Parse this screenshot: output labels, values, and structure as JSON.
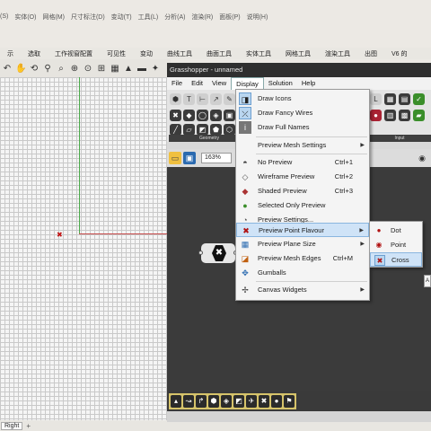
{
  "rhino": {
    "menu": [
      "(S)",
      "实体(O)",
      "网格(M)",
      "尺寸标注(D)",
      "变动(T)",
      "工具(L)",
      "分析(A)",
      "渲染(R)",
      "面板(P)",
      "说明(H)"
    ],
    "toolbar_tabs": [
      "示",
      "选取",
      "工作视窗配置",
      "可见性",
      "变动",
      "曲线工具",
      "曲面工具",
      "实体工具",
      "网格工具",
      "渲染工具",
      "出图",
      "V6 的"
    ],
    "viewport_tab": "Right",
    "add_viewport_glyph": "+"
  },
  "grasshopper": {
    "title": "Grasshopper - unnamed",
    "menu": [
      "File",
      "Edit",
      "View",
      "Display",
      "Solution",
      "Help"
    ],
    "open_menu": "Display",
    "zoom": "163%",
    "ribbon_labels": [
      "Geometry",
      "Input"
    ]
  },
  "display_menu": {
    "items": [
      {
        "label": "Draw Icons",
        "shortcut": "",
        "submenu": false,
        "icon": "icons-icon"
      },
      {
        "label": "Draw Fancy Wires",
        "shortcut": "",
        "submenu": false,
        "icon": "fancy-wires-icon"
      },
      {
        "label": "Draw Full Names",
        "shortcut": "",
        "submenu": false,
        "icon": "full-names-icon"
      },
      {
        "label": "Preview Mesh Settings",
        "shortcut": "",
        "submenu": true,
        "icon": ""
      },
      {
        "label": "No Preview",
        "shortcut": "Ctrl+1",
        "submenu": false,
        "icon": "no-preview-icon"
      },
      {
        "label": "Wireframe Preview",
        "shortcut": "Ctrl+2",
        "submenu": false,
        "icon": "wireframe-icon"
      },
      {
        "label": "Shaded Preview",
        "shortcut": "Ctrl+3",
        "submenu": false,
        "icon": "shaded-icon"
      },
      {
        "label": "Selected Only Preview",
        "shortcut": "",
        "submenu": false,
        "icon": "selected-only-icon"
      },
      {
        "label": "Preview Settings...",
        "shortcut": "",
        "submenu": false,
        "icon": "preview-settings-icon"
      },
      {
        "label": "Preview Point Flavour",
        "shortcut": "",
        "submenu": true,
        "icon": "point-flavour-icon"
      },
      {
        "label": "Preview Plane Size",
        "shortcut": "",
        "submenu": true,
        "icon": "plane-size-icon"
      },
      {
        "label": "Preview Mesh Edges",
        "shortcut": "Ctrl+M",
        "submenu": false,
        "icon": "mesh-edges-icon"
      },
      {
        "label": "Gumballs",
        "shortcut": "",
        "submenu": false,
        "icon": "gumball-icon"
      },
      {
        "label": "Canvas Widgets",
        "shortcut": "",
        "submenu": true,
        "icon": "canvas-widgets-icon"
      }
    ]
  },
  "point_flavour_submenu": {
    "items": [
      "Dot",
      "Point",
      "Cross"
    ],
    "selected": "Cross"
  },
  "tooltip_stub": "A",
  "colors": {
    "gh_canvas": "#3b3b3b",
    "menu_highlight": "#cfe3f7",
    "axis_x": "#c84a4a",
    "axis_y": "#4aa84a"
  }
}
